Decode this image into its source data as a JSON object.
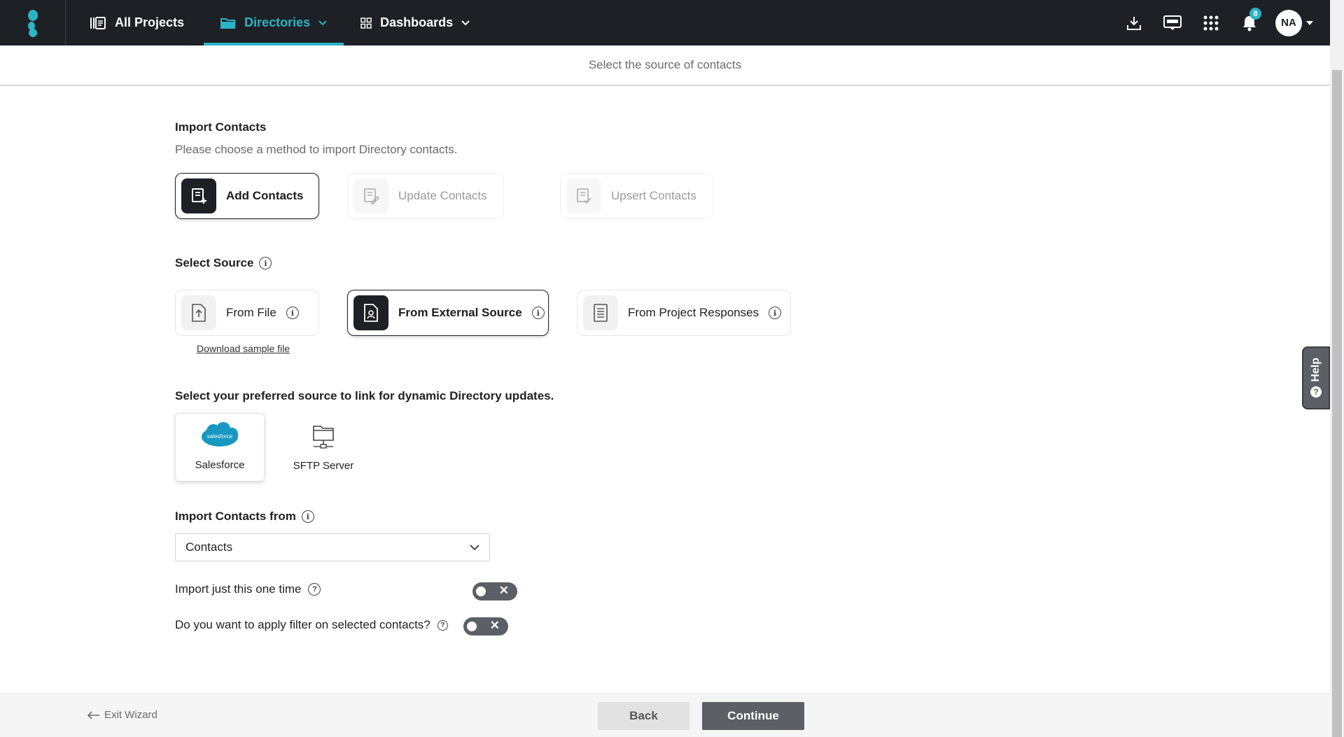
{
  "nav": {
    "all_projects": "All Projects",
    "directories": "Directories",
    "dashboards": "Dashboards",
    "notification_count": "8",
    "avatar_initials": "NA",
    "accent_color": "#2bb3c6"
  },
  "subheader": {
    "title": "Select the source of contacts"
  },
  "import_contacts": {
    "title": "Import Contacts",
    "subtitle": "Please choose a method to import Directory contacts.",
    "methods": [
      {
        "label": "Add Contacts",
        "state": "selected"
      },
      {
        "label": "Update Contacts",
        "state": "disabled"
      },
      {
        "label": "Upsert Contacts",
        "state": "disabled"
      }
    ]
  },
  "select_source": {
    "title": "Select Source",
    "sources": [
      {
        "label": "From File",
        "state": "default"
      },
      {
        "label": "From External Source",
        "state": "selected"
      },
      {
        "label": "From Project Responses",
        "state": "default"
      }
    ],
    "download_sample": "Download sample file"
  },
  "dynamic_source": {
    "title": "Select your preferred source to link for dynamic Directory updates.",
    "options": [
      {
        "label": "Salesforce",
        "logo_text": "salesforce",
        "state": "selected"
      },
      {
        "label": "SFTP Server",
        "state": "default"
      }
    ]
  },
  "import_from": {
    "title": "Import Contacts from",
    "selected": "Contacts"
  },
  "toggles": {
    "one_time": {
      "label": "Import just this one time",
      "value": false
    },
    "apply_filter": {
      "label": "Do you want to apply filter on selected contacts?",
      "value": false
    }
  },
  "help": {
    "label": "Help"
  },
  "footer": {
    "exit": "Exit Wizard",
    "back": "Back",
    "continue": "Continue"
  }
}
